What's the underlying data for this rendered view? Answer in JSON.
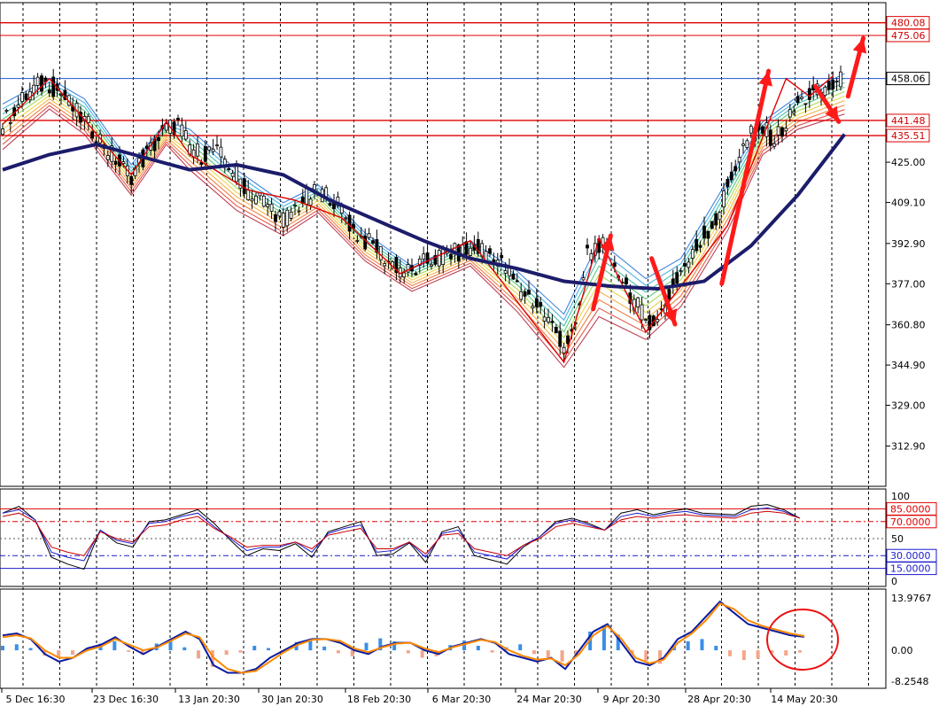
{
  "chart_data": [
    {
      "type": "candlestick",
      "panel": "price",
      "y_axis_labels": [
        "458.06",
        "425.00",
        "409.10",
        "392.90",
        "377.00",
        "360.80",
        "344.90",
        "329.00",
        "312.90"
      ],
      "y_label_values": [
        458.06,
        425.0,
        409.1,
        392.9,
        377.0,
        360.8,
        344.9,
        329.0,
        312.9
      ],
      "ylim": [
        297,
        488
      ],
      "horizontal_levels": [
        {
          "label": "480.08",
          "value": 480.08,
          "color": "#e00000"
        },
        {
          "label": "475.06",
          "value": 475.06,
          "color": "#e00000"
        },
        {
          "label": "458.06",
          "value": 458.06,
          "color": "#2255cc"
        },
        {
          "label": "441.48",
          "value": 441.48,
          "color": "#e00000"
        },
        {
          "label": "435.51",
          "value": 435.51,
          "color": "#e00000"
        }
      ],
      "price_path": [
        [
          0,
          440
        ],
        [
          1,
          446
        ],
        [
          2,
          451
        ],
        [
          3,
          455
        ],
        [
          4,
          456
        ],
        [
          5,
          452
        ],
        [
          6,
          446
        ],
        [
          7,
          441
        ],
        [
          8,
          436
        ],
        [
          9,
          430
        ],
        [
          10,
          424
        ],
        [
          11,
          420
        ],
        [
          12,
          426
        ],
        [
          13,
          432
        ],
        [
          14,
          438
        ],
        [
          15,
          440
        ],
        [
          16,
          431
        ],
        [
          17,
          428
        ],
        [
          18,
          430
        ],
        [
          19,
          426
        ],
        [
          20,
          420
        ],
        [
          21,
          414
        ],
        [
          22,
          411
        ],
        [
          23,
          407
        ],
        [
          24,
          402
        ],
        [
          25,
          407
        ],
        [
          26,
          411
        ],
        [
          27,
          413
        ],
        [
          28,
          412
        ],
        [
          29,
          406
        ],
        [
          30,
          398
        ],
        [
          31,
          394
        ],
        [
          32,
          391
        ],
        [
          33,
          386
        ],
        [
          34,
          383
        ],
        [
          35,
          381
        ],
        [
          36,
          385
        ],
        [
          37,
          387
        ],
        [
          38,
          389
        ],
        [
          39,
          389
        ],
        [
          40,
          390
        ],
        [
          41,
          391
        ],
        [
          42,
          388
        ],
        [
          43,
          383
        ],
        [
          44,
          376
        ],
        [
          45,
          372
        ],
        [
          46,
          367
        ],
        [
          47,
          360
        ],
        [
          48,
          353
        ],
        [
          49,
          358
        ],
        [
          50,
          389
        ],
        [
          51,
          393
        ],
        [
          52,
          388
        ],
        [
          53,
          379
        ],
        [
          54,
          370
        ],
        [
          55,
          363
        ],
        [
          56,
          362
        ],
        [
          57,
          373
        ],
        [
          58,
          382
        ],
        [
          59,
          388
        ],
        [
          60,
          396
        ],
        [
          61,
          402
        ],
        [
          62,
          415
        ],
        [
          63,
          428
        ],
        [
          64,
          436
        ],
        [
          65,
          438
        ],
        [
          66,
          434
        ],
        [
          67,
          440
        ],
        [
          68,
          448
        ],
        [
          69,
          451
        ],
        [
          70,
          453
        ],
        [
          71,
          455
        ],
        [
          72,
          458
        ]
      ],
      "envelope_top": [
        [
          0,
          448
        ],
        [
          4,
          458
        ],
        [
          7,
          450
        ],
        [
          11,
          424
        ],
        [
          14,
          441
        ],
        [
          16,
          438
        ],
        [
          20,
          422
        ],
        [
          24,
          409
        ],
        [
          27,
          416
        ],
        [
          31,
          397
        ],
        [
          35,
          384
        ],
        [
          40,
          394
        ],
        [
          44,
          382
        ],
        [
          48,
          365
        ],
        [
          51,
          394
        ],
        [
          55,
          379
        ],
        [
          58,
          387
        ],
        [
          62,
          418
        ],
        [
          65,
          441
        ],
        [
          68,
          451
        ],
        [
          72,
          460
        ]
      ],
      "envelope_bottom": [
        [
          0,
          430
        ],
        [
          4,
          446
        ],
        [
          7,
          436
        ],
        [
          11,
          412
        ],
        [
          14,
          432
        ],
        [
          16,
          422
        ],
        [
          20,
          406
        ],
        [
          24,
          396
        ],
        [
          27,
          405
        ],
        [
          31,
          386
        ],
        [
          35,
          374
        ],
        [
          40,
          384
        ],
        [
          44,
          366
        ],
        [
          48,
          344
        ],
        [
          51,
          364
        ],
        [
          55,
          355
        ],
        [
          58,
          368
        ],
        [
          62,
          398
        ],
        [
          65,
          428
        ],
        [
          68,
          438
        ],
        [
          72,
          444
        ]
      ],
      "ma_line": [
        [
          0,
          422
        ],
        [
          4,
          428
        ],
        [
          8,
          432
        ],
        [
          12,
          427
        ],
        [
          16,
          422
        ],
        [
          20,
          424
        ],
        [
          24,
          420
        ],
        [
          28,
          410
        ],
        [
          32,
          402
        ],
        [
          36,
          394
        ],
        [
          40,
          387
        ],
        [
          44,
          383
        ],
        [
          48,
          378
        ],
        [
          52,
          376
        ],
        [
          56,
          375
        ],
        [
          60,
          378
        ],
        [
          64,
          392
        ],
        [
          68,
          412
        ],
        [
          72,
          436
        ]
      ],
      "red_arrows": [
        {
          "from": [
            50.5,
            367
          ],
          "to": [
            52.0,
            396
          ]
        },
        {
          "from": [
            55.5,
            387
          ],
          "to": [
            57.5,
            361
          ]
        },
        {
          "from": [
            61.5,
            377
          ],
          "to": [
            65.5,
            461
          ]
        },
        {
          "from": [
            69.5,
            455
          ],
          "to": [
            71.5,
            441
          ]
        },
        {
          "from": [
            72.3,
            451
          ],
          "to": [
            73.6,
            474
          ]
        }
      ],
      "x_tick_labels": [
        "5 Dec 16:30",
        "23 Dec 16:30",
        "13 Jan 20:30",
        "30 Jan 20:30",
        "18 Feb 20:30",
        "6 Mar 20:30",
        "24 Mar 20:30",
        "9 Apr 20:30",
        "28 Apr 20:30",
        "14 May 20:30"
      ],
      "grid": true
    },
    {
      "type": "line",
      "panel": "oscillator",
      "y_axis_labels": [
        "100",
        "50",
        "0"
      ],
      "ylim": [
        0,
        100
      ],
      "levels": [
        {
          "label": "85.0000",
          "value": 85,
          "color": "#e00000"
        },
        {
          "label": "70.0000",
          "value": 70,
          "color": "#e00000"
        },
        {
          "label": "30.0000",
          "value": 30,
          "color": "#1a1acc"
        },
        {
          "label": "15.0000",
          "value": 15,
          "color": "#1a1acc"
        }
      ],
      "series": [
        {
          "color": "#000000",
          "values": [
            80,
            88,
            72,
            28,
            20,
            14,
            60,
            45,
            40,
            70,
            72,
            78,
            84,
            68,
            48,
            30,
            38,
            36,
            44,
            28,
            58,
            64,
            70,
            30,
            32,
            45,
            22,
            58,
            64,
            30,
            25,
            20,
            40,
            52,
            70,
            74,
            68,
            60,
            80,
            84,
            78,
            82,
            85,
            80,
            79,
            78,
            88,
            90,
            84,
            74
          ]
        },
        {
          "color": "#1a1acc",
          "values": [
            80,
            84,
            72,
            34,
            28,
            24,
            60,
            48,
            44,
            68,
            70,
            76,
            80,
            64,
            50,
            36,
            40,
            40,
            46,
            34,
            56,
            62,
            66,
            34,
            36,
            46,
            28,
            56,
            60,
            34,
            30,
            26,
            42,
            52,
            68,
            72,
            66,
            60,
            76,
            80,
            76,
            80,
            82,
            78,
            77,
            76,
            84,
            86,
            82,
            74
          ]
        },
        {
          "color": "#cc0000",
          "values": [
            76,
            80,
            70,
            40,
            34,
            30,
            58,
            50,
            46,
            64,
            66,
            72,
            76,
            62,
            52,
            40,
            42,
            42,
            46,
            38,
            54,
            58,
            62,
            38,
            38,
            46,
            32,
            54,
            56,
            38,
            34,
            30,
            42,
            50,
            64,
            68,
            64,
            60,
            72,
            76,
            74,
            77,
            78,
            76,
            75,
            74,
            80,
            82,
            80,
            74
          ]
        }
      ]
    },
    {
      "type": "bar+line",
      "panel": "macd",
      "y_axis_labels": [
        "13.9767",
        "0.00",
        "-8.2548"
      ],
      "ylim": [
        -8.2548,
        13.9767
      ],
      "histogram": [
        1.2,
        1.6,
        0.6,
        -1.4,
        -2.0,
        -1.2,
        0.4,
        1.8,
        2.4,
        -0.4,
        -1.2,
        1.8,
        2.8,
        0.8,
        -2.2,
        -4.4,
        -1.2,
        -0.6,
        1.2,
        0.6,
        -0.6,
        2.2,
        2.6,
        1.0,
        -0.8,
        -1.6,
        2.0,
        3.2,
        2.4,
        -0.8,
        -2.0,
        -1.6,
        1.4,
        2.6,
        1.2,
        -0.6,
        0.8,
        1.6,
        -1.0,
        -2.4,
        -3.0,
        -1.2,
        5.0,
        6.6,
        4.2,
        -0.8,
        -2.8,
        -3.6,
        1.2,
        2.4,
        3.0,
        1.2,
        -1.6,
        -2.6,
        -2.2,
        -0.8,
        -1.4,
        -0.6
      ],
      "series": [
        {
          "color": "#0a1aa0",
          "values": [
            4,
            4.5,
            3,
            -1,
            -3,
            -2,
            0.5,
            1.5,
            3.5,
            1,
            -1,
            1,
            3,
            5,
            3,
            -4,
            -6,
            -6,
            -5,
            -2,
            0,
            2,
            3,
            3,
            2,
            0,
            -1,
            1,
            2,
            2,
            0,
            -1,
            1,
            2,
            3,
            2,
            -1,
            -2,
            -3,
            -2,
            -5,
            0,
            5,
            7,
            2,
            -3,
            -4,
            -2,
            3,
            5,
            9,
            13,
            10,
            7,
            6,
            5,
            4,
            3.6
          ]
        },
        {
          "color": "#ff8800",
          "values": [
            3.5,
            4,
            3.2,
            0,
            -2,
            -2,
            0,
            1,
            3,
            1.5,
            0,
            0.8,
            2.6,
            4.5,
            3.5,
            -2,
            -5,
            -6,
            -5.5,
            -3,
            -0.5,
            1.5,
            2.8,
            3,
            2.5,
            0.5,
            -0.5,
            0.8,
            1.8,
            2,
            0.5,
            -0.5,
            0.8,
            1.8,
            2.8,
            2.2,
            0,
            -1.5,
            -2.5,
            -2.2,
            -4,
            -1,
            4,
            6.5,
            3,
            -2,
            -3.5,
            -2.5,
            2,
            4.5,
            8,
            12.5,
            11,
            8,
            6.5,
            5.5,
            4.5,
            3.8
          ]
        }
      ]
    }
  ]
}
